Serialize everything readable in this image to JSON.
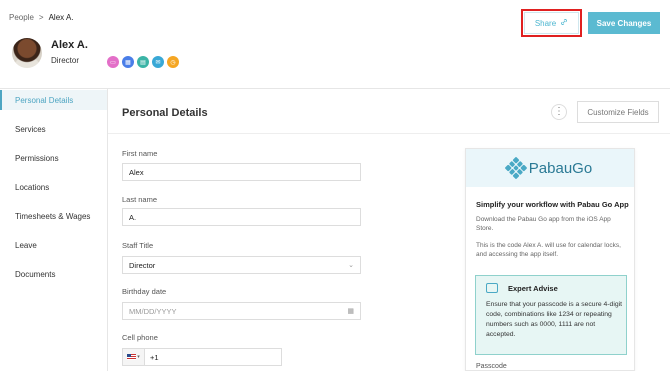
{
  "breadcrumb": {
    "root": "People",
    "separator": ">",
    "current": "Alex A."
  },
  "user": {
    "name": "Alex A.",
    "role": "Director"
  },
  "app_icons": [
    {
      "icon": "inbox-icon",
      "color": "#e36fc8"
    },
    {
      "icon": "calendar-icon",
      "color": "#4a7ee8"
    },
    {
      "icon": "calculator-icon",
      "color": "#3bb4a6"
    },
    {
      "icon": "mail-icon",
      "color": "#39a8d6"
    },
    {
      "icon": "clock-icon",
      "color": "#f5a623"
    }
  ],
  "header": {
    "share_label": "Share",
    "save_label": "Save Changes"
  },
  "sidebar": {
    "items": [
      {
        "label": "Personal Details",
        "active": true
      },
      {
        "label": "Services"
      },
      {
        "label": "Permissions"
      },
      {
        "label": "Locations"
      },
      {
        "label": "Timesheets & Wages"
      },
      {
        "label": "Leave"
      },
      {
        "label": "Documents"
      }
    ]
  },
  "main": {
    "title": "Personal Details",
    "kebab": "⋮",
    "customize_label": "Customize Fields",
    "fields": {
      "first_name": {
        "label": "First name",
        "value": "Alex"
      },
      "last_name": {
        "label": "Last name",
        "value": "A."
      },
      "staff_title": {
        "label": "Staff Title",
        "value": "Director"
      },
      "birthday": {
        "label": "Birthday date",
        "placeholder": "MM/DD/YYYY"
      },
      "cell_phone": {
        "label": "Cell phone",
        "code": "+1"
      }
    }
  },
  "promo": {
    "logo_text": "PabauGo",
    "title": "Simplify your workflow with Pabau Go App",
    "text1": "Download the Pabau Go app from the iOS App Store.",
    "text2": "This is the code Alex A. will use for calendar locks, and accessing the app itself.",
    "advise_title": "Expert Advise",
    "advise_body": "Ensure that your passcode is a secure 4-digit code, combinations like 1234 or repeating numbers such as 0000, 1111 are not accepted.",
    "passcode_label": "Passcode"
  }
}
